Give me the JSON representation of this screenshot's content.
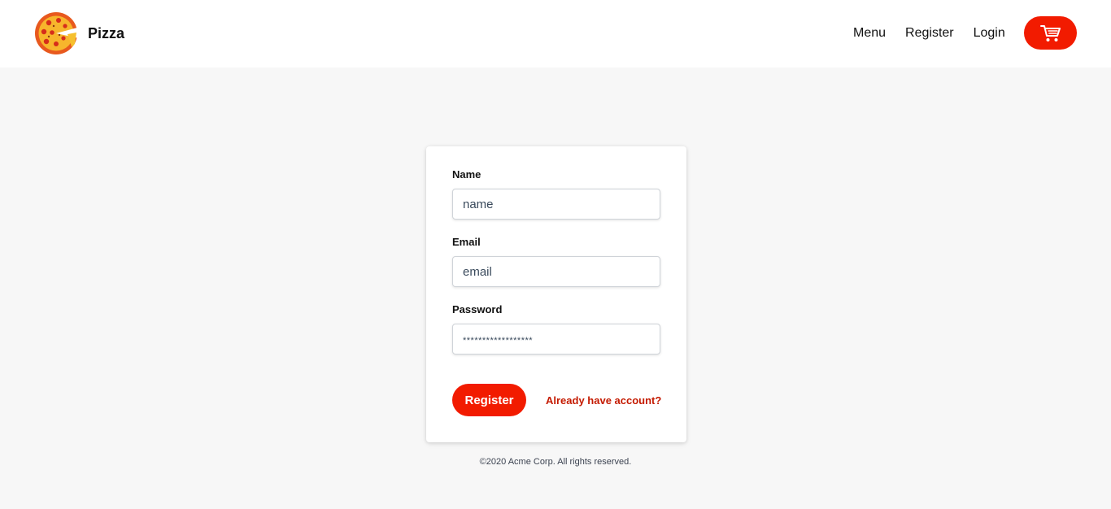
{
  "brand": {
    "name": "Pizza",
    "logo_icon": "pizza-icon"
  },
  "nav": {
    "items": [
      {
        "label": "Menu"
      },
      {
        "label": "Register"
      },
      {
        "label": "Login"
      }
    ],
    "cart_icon": "shopping-cart-icon"
  },
  "form": {
    "name_label": "Name",
    "name_placeholder": "name",
    "email_label": "Email",
    "email_placeholder": "email",
    "password_label": "Password",
    "password_placeholder": "******************",
    "submit_label": "Register",
    "login_link": "Already have account?"
  },
  "footer": {
    "text": "©2020 Acme Corp. All rights reserved."
  },
  "colors": {
    "accent": "#f21b00",
    "link": "#c41a00",
    "background": "#f7f7f7",
    "card": "#ffffff"
  }
}
